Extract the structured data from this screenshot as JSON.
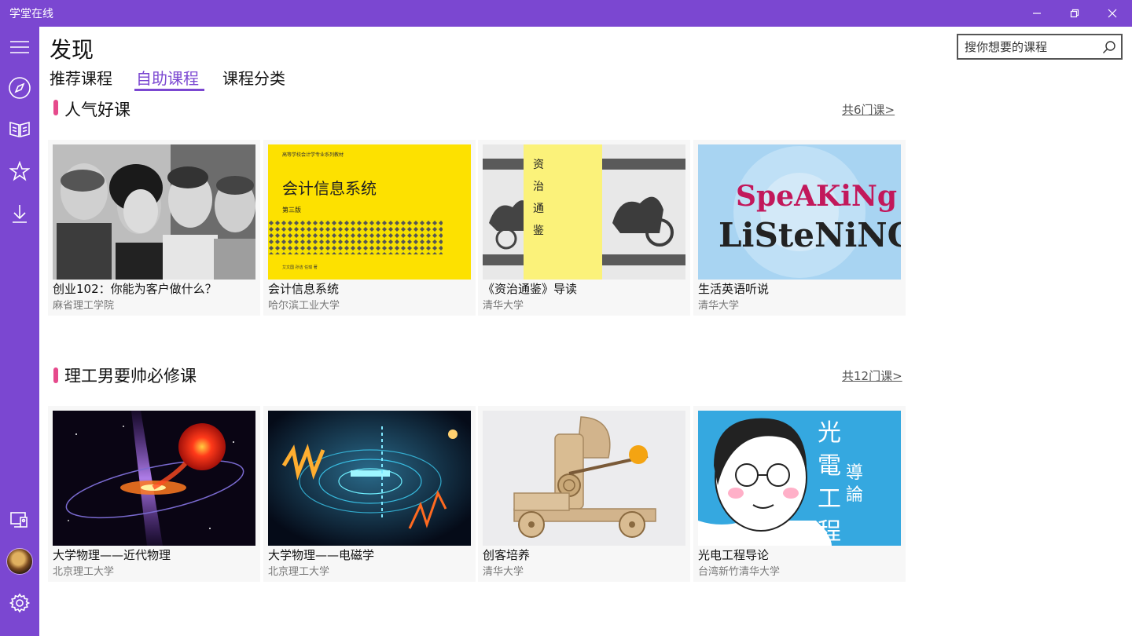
{
  "window": {
    "title": "学堂在线"
  },
  "header": {
    "page_title": "发现",
    "tabs": [
      {
        "label": "推荐课程",
        "active": false
      },
      {
        "label": "自助课程",
        "active": true
      },
      {
        "label": "课程分类",
        "active": false
      }
    ],
    "search_placeholder": "搜你想要的课程"
  },
  "sidebar": {
    "items": [
      "menu-icon",
      "compass-icon",
      "book-icon",
      "star-icon",
      "download-icon",
      "device-icon",
      "avatar",
      "gear-icon"
    ]
  },
  "sections": [
    {
      "title": "人气好课",
      "more": "共6门课>",
      "courses": [
        {
          "title": "创业102：你能为客户做什么？",
          "school": "麻省理工学院"
        },
        {
          "title": "会计信息系统",
          "school": "哈尔滨工业大学"
        },
        {
          "title": "《资治通鉴》导读",
          "school": "清华大学"
        },
        {
          "title": "生活英语听说",
          "school": "清华大学"
        }
      ]
    },
    {
      "title": "理工男要帅必修课",
      "more": "共12门课>",
      "courses": [
        {
          "title": "大学物理——近代物理",
          "school": "北京理工大学"
        },
        {
          "title": "大学物理——电磁学",
          "school": "北京理工大学"
        },
        {
          "title": "创客培养",
          "school": "清华大学"
        },
        {
          "title": "光电工程导论",
          "school": "台湾新竹清华大学"
        }
      ]
    }
  ],
  "thumbnails": {
    "accounting": {
      "series": "高等学校会计学专业系列教材",
      "title": "会计信息系统",
      "edition": "第三版",
      "authors": "艾文国  孙洁  任琪  著"
    },
    "zizhi": {
      "title": "资治通鉴"
    },
    "english": {
      "line1": "SpeAKiNg",
      "line2": "LiSteNiNG"
    },
    "optics": {
      "chars_big": [
        "光",
        "電",
        "工",
        "程"
      ],
      "chars_small": [
        "導",
        "論"
      ]
    }
  },
  "colors": {
    "brand": "#7b47d1",
    "accent_marker": "#e64a8c",
    "card_bg": "#f7f7f7"
  }
}
